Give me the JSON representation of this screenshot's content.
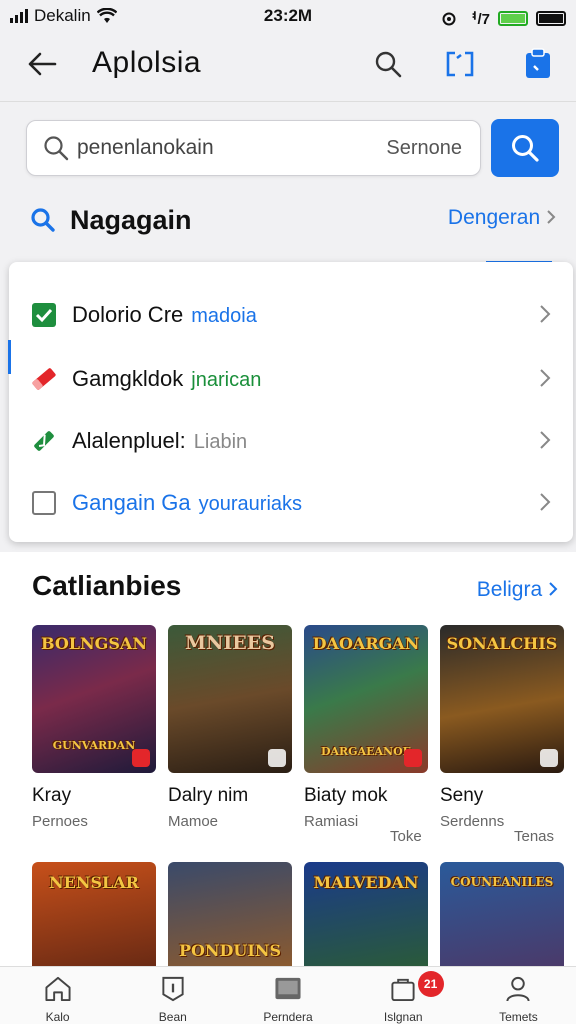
{
  "status": {
    "carrier": "Dekalin",
    "time": "23:2M",
    "right_text": "ᅧ/7"
  },
  "header": {
    "title": "Aplolsia"
  },
  "search": {
    "placeholder": "penenlanokain",
    "hint": "Sernone"
  },
  "section": {
    "title": "Nagagain",
    "link": "Dengeran"
  },
  "dropdown": {
    "items": [
      {
        "label": "Dolorio Cre",
        "sub": "madoia",
        "sub_color": "#1a73e8",
        "icon": "green-checkbox-icon"
      },
      {
        "label": "Gamgkldok",
        "sub": "jnarican",
        "sub_color": "#1a8f3a",
        "icon": "red-eraser-icon"
      },
      {
        "label": "Alalenpluel:",
        "sub": "Liabin",
        "sub_color": "#888888",
        "icon": "green-pencil-icon"
      },
      {
        "label": "Gangain Ga",
        "sub": "yourauriaks",
        "sub_color": "#1a73e8",
        "icon": "empty-checkbox-icon",
        "label_color": "#1a73e8"
      }
    ]
  },
  "categories": {
    "title": "Catlianbies",
    "link": "Beligra",
    "cards": [
      {
        "art_text": "BOLNGSAN",
        "art_sub": "GUNVARDAN",
        "title": "Kray",
        "sub": "Pernoes"
      },
      {
        "art_text": "MNIEES",
        "art_sub": "",
        "title": "Dalry nim",
        "sub": "Mamoe"
      },
      {
        "art_text": "DAOARGAN",
        "art_sub": "DARGAEANOE",
        "title": "Biaty mok",
        "sub": "Ramiasi"
      },
      {
        "art_text": "SONALCHIS",
        "art_sub": "",
        "title": "Seny",
        "sub": "Serdenns"
      }
    ],
    "extra_subs": [
      "Toke",
      "Tenas"
    ],
    "row2": [
      {
        "art_text": "NENSLAR"
      },
      {
        "art_text": "PONDUINS"
      },
      {
        "art_text": "MALVEDAN"
      },
      {
        "art_text": "COUNEANILES"
      }
    ]
  },
  "tabs": [
    {
      "label": "Kalo",
      "icon": "home-icon"
    },
    {
      "label": "Bean",
      "icon": "info-icon"
    },
    {
      "label": "Perndera",
      "icon": "image-icon"
    },
    {
      "label": "Islgnan",
      "icon": "bag-icon",
      "badge": "21"
    },
    {
      "label": "Temets",
      "icon": "person-icon"
    }
  ],
  "colors": {
    "accent": "#1a73e8",
    "header_bg": "#f1f1f3",
    "badge": "#e3262a"
  }
}
